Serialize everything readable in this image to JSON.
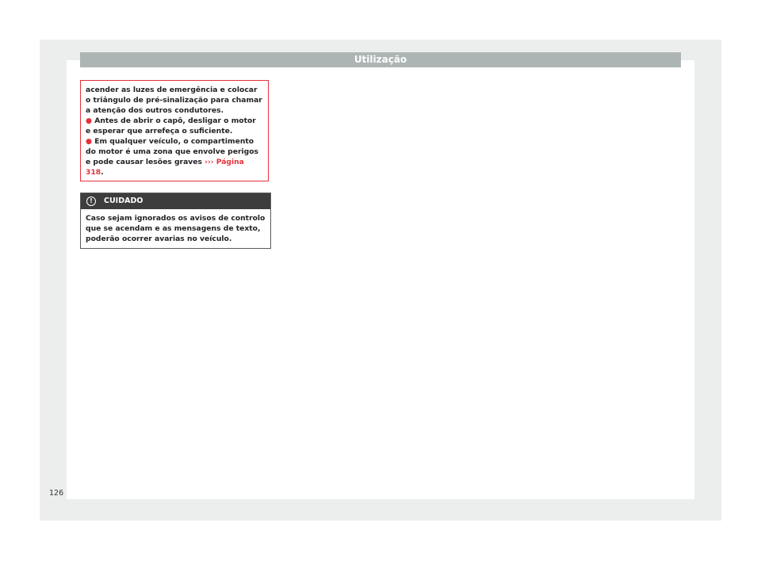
{
  "header": {
    "title": "Utilização"
  },
  "warning": {
    "paragraph": "acender as luzes de emergência e colocar o triângulo de pré-sinalização para chamar a atenção dos outros condutores.",
    "bullet_symbol": "●",
    "bullet_1": "Antes de abrir o capô, desligar o motor e esperar que arrefeça o suficiente.",
    "bullet_2_text": "Em qualquer veículo, o compartimento do motor é uma zona que envolve perigos e pode causar lesões graves",
    "bullet_2_arrows": "›››",
    "bullet_2_link": "Página 318",
    "bullet_2_end": "."
  },
  "caution": {
    "icon": "!",
    "title": "CUIDADO",
    "body": "Caso sejam ignorados os avisos de controlo que se acendam e as mensagens de texto, poderão ocorrer avarias no veículo."
  },
  "page_number": "126",
  "colors": {
    "accent": "#e4323a",
    "header_bar": "#adb5b4",
    "caution_header": "#3d3d3d"
  }
}
